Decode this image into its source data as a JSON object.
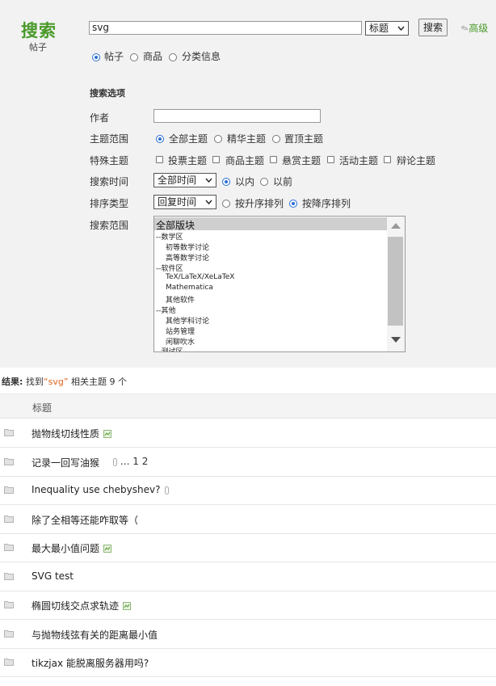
{
  "header": {
    "title": "搜索",
    "subtitle": "帖子",
    "query": "svg",
    "scope_select": "标题",
    "search_button": "搜索",
    "advanced_link": "高级"
  },
  "type_options": [
    {
      "label": "帖子",
      "checked": true
    },
    {
      "label": "商品",
      "checked": false
    },
    {
      "label": "分类信息",
      "checked": false
    }
  ],
  "options": {
    "section_title": "搜索选项",
    "author_label": "作者",
    "author_value": "",
    "topic_range_label": "主题范围",
    "topic_range": [
      {
        "label": "全部主题",
        "checked": true
      },
      {
        "label": "精华主题",
        "checked": false
      },
      {
        "label": "置顶主题",
        "checked": false
      }
    ],
    "special_label": "特殊主题",
    "special": [
      "投票主题",
      "商品主题",
      "悬赏主题",
      "活动主题",
      "辩论主题"
    ],
    "time_label": "搜索时间",
    "time_select": "全部时间",
    "time_radios": [
      {
        "label": "以内",
        "checked": true
      },
      {
        "label": "以前",
        "checked": false
      }
    ],
    "sort_label": "排序类型",
    "sort_select": "回复时间",
    "sort_radios": [
      {
        "label": "按升序排列",
        "checked": false
      },
      {
        "label": "按降序排列",
        "checked": true
      }
    ],
    "forum_label": "搜索范围",
    "forums": [
      "全部版块",
      "--数学区",
      "初等数学讨论",
      "高等数学讨论",
      "--软件区",
      "TeX/LaTeX/XeLaTeX",
      "Mathematica",
      "其他软件",
      "--其他",
      "其他学科讨论",
      "站务管理",
      "闲聊吹水",
      "--测试区"
    ]
  },
  "results": {
    "prefix": "结果:",
    "found": "找到",
    "keyword": "“svg”",
    "suffix": "相关主题 9 个",
    "column_title": "标题",
    "rows": [
      {
        "title": "抛物线切线性质",
        "extra": ""
      },
      {
        "title": "记录一回写油猴",
        "extra": "... 1 2"
      },
      {
        "title": "Inequality use chebyshev?",
        "extra": ""
      },
      {
        "title": "除了全相等还能咋取等（",
        "extra": ""
      },
      {
        "title": "最大最小值问题",
        "extra": ""
      },
      {
        "title": "SVG test",
        "extra": ""
      },
      {
        "title": "椭圆切线交点求轨迹",
        "extra": ""
      },
      {
        "title": "与抛物线弦有关的距离最小值",
        "extra": ""
      },
      {
        "title": "tikzjax 能脱离服务器用吗?",
        "extra": ""
      }
    ]
  },
  "colors": {
    "brand": "#4a9a2a",
    "keyword": "#e0651e",
    "radio_selected": "#2a6fd6"
  }
}
